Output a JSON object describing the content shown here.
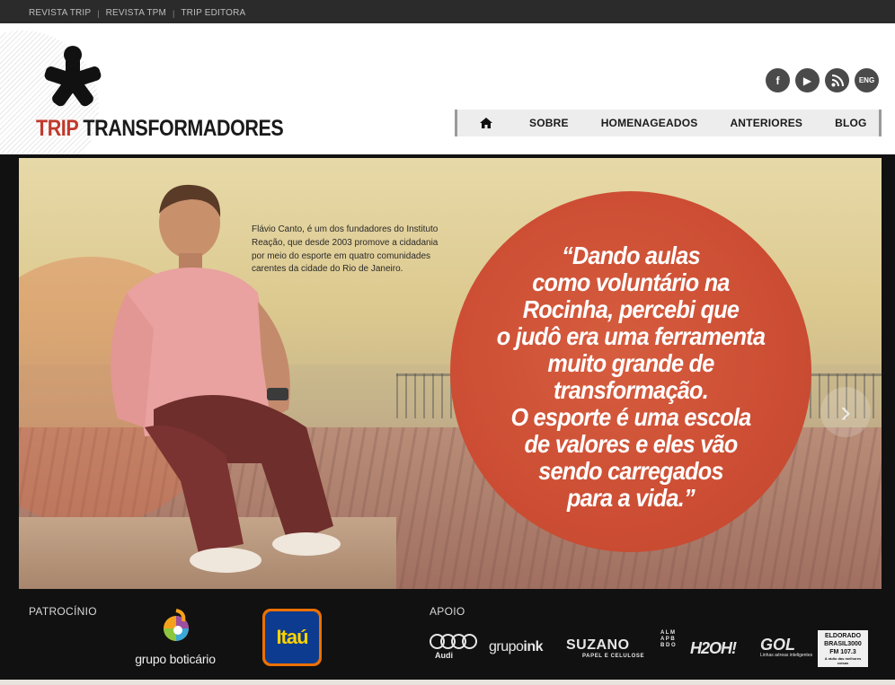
{
  "topbar": {
    "links": [
      "REVISTA TRIP",
      "REVISTA TPM",
      "TRIP EDITORA"
    ],
    "separator": "|"
  },
  "logo": {
    "word1": "TRIP",
    "word2": "TRANSFORMADORES",
    "icon": "asterisk-logo-icon"
  },
  "social": {
    "facebook": "f",
    "youtube": "▶",
    "rss": "rss",
    "eng": "ENG"
  },
  "nav": {
    "home_icon": "home-icon",
    "items": [
      "SOBRE",
      "HOMENAGEADOS",
      "ANTERIORES",
      "BLOG"
    ]
  },
  "hero": {
    "blurb": "Flávio Canto, é um dos fundadores do Instituto Reação, que desde 2003 promove a cidadania por meio do esporte em quatro comunidades carentes da cidade do Rio de Janeiro.",
    "quote_lines": [
      "“Dando aulas",
      "como voluntário na",
      "Rocinha, percebi que",
      "o judô era uma ferramenta",
      "muito grande de",
      "transformação.",
      "O esporte é uma escola",
      "de valores e eles vão",
      "sendo carregados",
      "para a vida.”"
    ],
    "next_arrow": "›",
    "quote_color": "#cc4d33"
  },
  "sponsors": {
    "patrocinio_label": "PATROCÍNIO",
    "apoio_label": "APOIO",
    "boticario": "grupo boticário",
    "itau": "Itaú",
    "audi": "Audi",
    "grupoink": {
      "a": "grupo",
      "b": "ink"
    },
    "suzano": {
      "name": "SUZANO",
      "sub": "PAPEL E CELULOSE"
    },
    "almap": "A L M A P   B B D O",
    "h2oh": "H2OH!",
    "gol": {
      "name": "GOL",
      "sub": "Linhas aéreas inteligentes"
    },
    "eldorado": [
      "ELDORADO",
      "BRASIL3000",
      "FM 107.3",
      "A rádio das melhores coisas"
    ]
  }
}
